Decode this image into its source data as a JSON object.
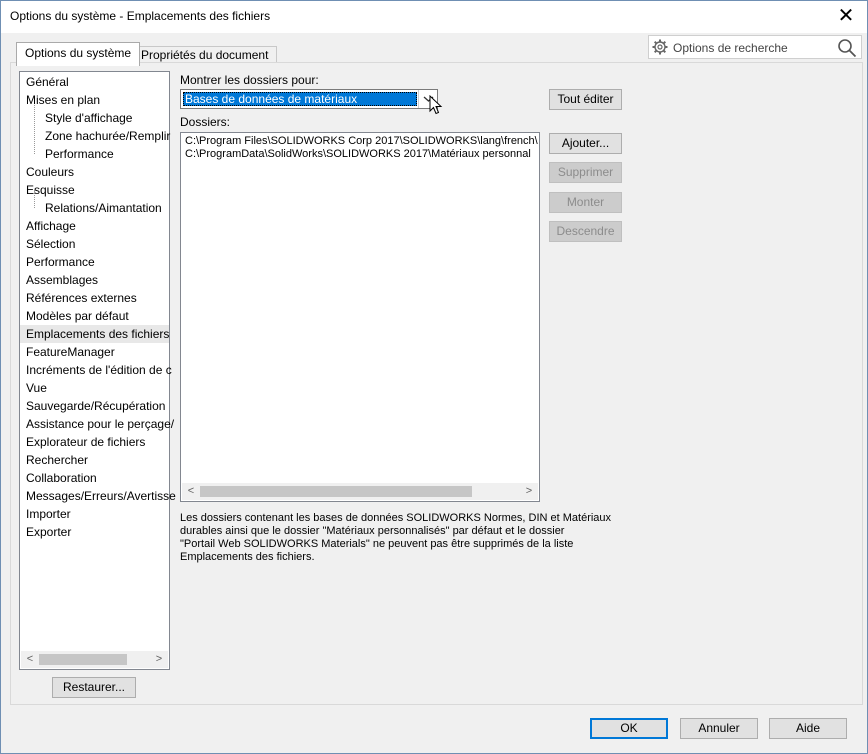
{
  "window": {
    "title": "Options du système - Emplacements des fichiers"
  },
  "tabs": [
    {
      "label": "Options du système",
      "active": true
    },
    {
      "label": "Propriétés du document",
      "active": false
    }
  ],
  "search": {
    "placeholder": "Options de recherche"
  },
  "tree": [
    {
      "label": "Général",
      "level": 0
    },
    {
      "label": "Mises en plan",
      "level": 0
    },
    {
      "label": "Style d'affichage",
      "level": 1
    },
    {
      "label": "Zone hachurée/Remplir",
      "level": 1
    },
    {
      "label": "Performance",
      "level": 1
    },
    {
      "label": "Couleurs",
      "level": 0
    },
    {
      "label": "Esquisse",
      "level": 0
    },
    {
      "label": "Relations/Aimantation",
      "level": 1
    },
    {
      "label": "Affichage",
      "level": 0
    },
    {
      "label": "Sélection",
      "level": 0
    },
    {
      "label": "Performance",
      "level": 0
    },
    {
      "label": "Assemblages",
      "level": 0
    },
    {
      "label": "Références externes",
      "level": 0
    },
    {
      "label": "Modèles par défaut",
      "level": 0
    },
    {
      "label": "Emplacements des fichiers",
      "level": 0,
      "selected": true
    },
    {
      "label": "FeatureManager",
      "level": 0
    },
    {
      "label": "Incréments de l'édition de c",
      "level": 0
    },
    {
      "label": "Vue",
      "level": 0
    },
    {
      "label": "Sauvegarde/Récupération",
      "level": 0
    },
    {
      "label": "Assistance pour le perçage/",
      "level": 0
    },
    {
      "label": "Explorateur de fichiers",
      "level": 0
    },
    {
      "label": "Rechercher",
      "level": 0
    },
    {
      "label": "Collaboration",
      "level": 0
    },
    {
      "label": "Messages/Erreurs/Avertisse",
      "level": 0
    },
    {
      "label": "Importer",
      "level": 0
    },
    {
      "label": "Exporter",
      "level": 0
    }
  ],
  "show_folders": {
    "label": "Montrer les dossiers pour:",
    "value": "Bases de données de matériaux"
  },
  "folders": {
    "label": "Dossiers:",
    "items": [
      "C:\\Program Files\\SOLIDWORKS Corp 2017\\SOLIDWORKS\\lang\\french\\",
      "C:\\ProgramData\\SolidWorks\\SOLIDWORKS 2017\\Matériaux personnal"
    ]
  },
  "buttons": {
    "edit_all": "Tout éditer",
    "add": "Ajouter...",
    "delete": "Supprimer",
    "up": "Monter",
    "down": "Descendre",
    "restore": "Restaurer...",
    "ok": "OK",
    "cancel": "Annuler",
    "help": "Aide"
  },
  "note_lines": [
    "Les dossiers contenant les bases de données SOLIDWORKS Normes, DIN et Matériaux",
    "durables ainsi que le dossier \"Matériaux personnalisés\" par défaut et le dossier",
    "\"Portail Web SOLIDWORKS Materials\" ne peuvent pas être supprimés de la liste",
    "Emplacements des fichiers."
  ],
  "colors": {
    "selection": "#0078d7",
    "window_border": "#6f8fb3"
  }
}
